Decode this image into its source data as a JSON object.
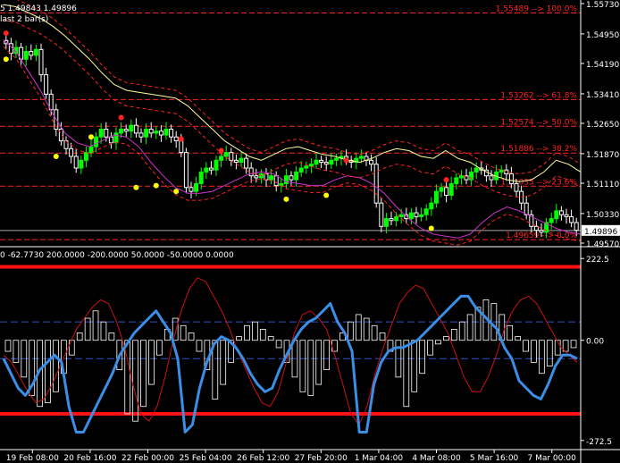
{
  "header": {
    "main_info": "5 1.49843 1.49896",
    "main_info2": "last 2 bar(s)",
    "ind_info": "0 -62.7730 200.0000 -200.0000 50.0000 -50.0000 0.0000"
  },
  "colors": {
    "background": "#000000",
    "axis": "#ffffff",
    "candle_bull": "#00ff00",
    "candle_bear": "#ffffff",
    "fib_line": "#ff2222",
    "env_line": "#ff2222",
    "outer_band": "#ffff99",
    "inner_band": "#cc33cc",
    "dot_top": "#ff2222",
    "dot_bottom": "#ffff00",
    "cci_main": "#3a8ee6",
    "cci_signal": "#cc1111",
    "cci_limit": "#ff1111",
    "cci_level": "#3355cc",
    "histogram": "#ffffff",
    "current_price_box": "#ffffff"
  },
  "chart_data": [
    {
      "type": "candlestick",
      "title": "",
      "ylim": [
        1.4957,
        1.5573
      ],
      "y_ticks": [
        "1.55730",
        "1.54950",
        "1.54190",
        "1.53410",
        "1.52650",
        "1.51870",
        "1.51110",
        "1.50330",
        "1.49896",
        "1.49570"
      ],
      "current_price": "1.49896",
      "fib_levels": [
        {
          "label": "1.55489 --> 100.0%",
          "value": 1.55489
        },
        {
          "label": "1.53262 --> 61.8%",
          "value": 1.53262
        },
        {
          "label": "1.52574 --> 50.0%",
          "value": 1.52574
        },
        {
          "label": "1.51886 --> 38.2%",
          "value": 1.51886
        },
        {
          "label": "1.51035 --> 23.6%",
          "value": 1.51035
        },
        {
          "label": "1.49659 --> 0.0%",
          "value": 1.49659
        }
      ],
      "close": [
        1.547,
        1.5445,
        1.546,
        1.543,
        1.545,
        1.544,
        1.5455,
        1.539,
        1.534,
        1.53,
        1.525,
        1.522,
        1.52,
        1.518,
        1.515,
        1.517,
        1.519,
        1.5205,
        1.523,
        1.525,
        1.523,
        1.5215,
        1.524,
        1.525,
        1.5245,
        1.526,
        1.524,
        1.523,
        1.525,
        1.524,
        1.5245,
        1.5235,
        1.525,
        1.523,
        1.522,
        1.519,
        1.51,
        1.509,
        1.511,
        1.514,
        1.515,
        1.5145,
        1.517,
        1.518,
        1.519,
        1.517,
        1.5165,
        1.5175,
        1.515,
        1.513,
        1.5125,
        1.5135,
        1.512,
        1.513,
        1.5105,
        1.511,
        1.513,
        1.512,
        1.514,
        1.515,
        1.5155,
        1.516,
        1.517,
        1.5165,
        1.516,
        1.517,
        1.5175,
        1.518,
        1.517,
        1.5165,
        1.5175,
        1.518,
        1.517,
        1.516,
        1.506,
        1.5,
        1.502,
        1.5015,
        1.5025,
        1.503,
        1.502,
        1.5035,
        1.5025,
        1.503,
        1.5045,
        1.506,
        1.509,
        1.51,
        1.508,
        1.511,
        1.5125,
        1.513,
        1.512,
        1.514,
        1.515,
        1.5145,
        1.513,
        1.512,
        1.514,
        1.5145,
        1.5135,
        1.511,
        1.509,
        1.506,
        1.503,
        1.5,
        1.499,
        1.4985,
        1.501,
        1.502,
        1.504,
        1.503,
        1.5025,
        1.501,
        1.499
      ],
      "outer_upper": [
        1.557,
        1.5565,
        1.555,
        1.5535,
        1.5515,
        1.549,
        1.546,
        1.543,
        1.5395,
        1.5365,
        1.535,
        1.5345,
        1.534,
        1.5335,
        1.533,
        1.531,
        1.528,
        1.525,
        1.522,
        1.52,
        1.518,
        1.517,
        1.5185,
        1.52,
        1.5205,
        1.5195,
        1.5185,
        1.518,
        1.517,
        1.5165,
        1.5175,
        1.519,
        1.52,
        1.5195,
        1.518,
        1.5175,
        1.5195,
        1.5175,
        1.5165,
        1.5145,
        1.513,
        1.512,
        1.5115,
        1.512,
        1.514,
        1.517,
        1.516,
        1.514
      ],
      "outer_lower": [
        1.548,
        1.545,
        1.54,
        1.535,
        1.529,
        1.524,
        1.5215,
        1.5205,
        1.522,
        1.5235,
        1.523,
        1.5205,
        1.5165,
        1.513,
        1.51,
        1.5085,
        1.5085,
        1.509,
        1.5105,
        1.512,
        1.5135,
        1.514,
        1.5135,
        1.5115,
        1.511,
        1.5105,
        1.5105,
        1.512,
        1.513,
        1.5125,
        1.511,
        1.5085,
        1.505,
        1.502,
        1.4995,
        1.498,
        1.4975,
        1.497,
        1.498,
        1.501,
        1.5035,
        1.505,
        1.504,
        1.5025,
        1.501,
        1.4995,
        1.4985,
        1.498
      ],
      "dots_top": [
        [
          0,
          1.5497
        ],
        [
          23,
          1.528
        ],
        [
          35,
          1.5225
        ],
        [
          43,
          1.5195
        ],
        [
          68,
          1.517
        ],
        [
          88,
          1.512
        ]
      ],
      "dots_bottom": [
        [
          0,
          1.543
        ],
        [
          10,
          1.518
        ],
        [
          17,
          1.523
        ],
        [
          26,
          1.51
        ],
        [
          30,
          1.5105
        ],
        [
          34,
          1.509
        ],
        [
          56,
          1.507
        ],
        [
          64,
          1.508
        ],
        [
          85,
          1.4995
        ]
      ]
    },
    {
      "type": "line",
      "title": "",
      "ylim": [
        -290,
        240
      ],
      "y_ticks": [
        "222.5",
        "0.00",
        "-272.5"
      ],
      "levels": {
        "upper": 200,
        "lower": -200,
        "mid_high": 50,
        "mid_low": -50,
        "zero": 0
      },
      "series": [
        {
          "values": [
            -50,
            -90,
            -130,
            -150,
            -120,
            -80,
            -60,
            -40,
            -60,
            -180,
            -250,
            -250,
            -210,
            -170,
            -130,
            -90,
            -40,
            -10,
            20,
            40,
            60,
            80,
            50,
            20,
            -50,
            -250,
            -230,
            -130,
            -60,
            -10,
            10,
            0,
            -20,
            -50,
            -90,
            -120,
            -140,
            -130,
            -80,
            -40,
            0,
            30,
            50,
            60,
            80,
            100,
            50,
            20,
            -30,
            -250,
            -250,
            -120,
            -60,
            -30,
            -20,
            -20,
            -10,
            0,
            20,
            40,
            60,
            80,
            100,
            120,
            120,
            90,
            70,
            50,
            30,
            -20,
            -50,
            -110,
            -130,
            -150,
            -160,
            -120,
            -70,
            -40,
            -40,
            -50
          ]
        },
        {
          "values": [
            -40,
            -60,
            -100,
            -140,
            -170,
            -160,
            -120,
            -70,
            -20,
            30,
            60,
            90,
            110,
            100,
            50,
            -20,
            -120,
            -200,
            -220,
            -180,
            -100,
            0,
            80,
            140,
            170,
            160,
            120,
            80,
            30,
            -30,
            -80,
            -130,
            -170,
            -180,
            -140,
            -60,
            20,
            70,
            80,
            60,
            30,
            -40,
            -120,
            -200,
            -230,
            -180,
            -90,
            -20,
            40,
            100,
            130,
            150,
            140,
            100,
            60,
            20,
            -40,
            -100,
            -140,
            -140,
            -100,
            -40,
            30,
            80,
            110,
            120,
            100,
            60,
            20,
            -20,
            -40,
            -60
          ]
        }
      ],
      "histogram": [
        -30,
        -60,
        -100,
        -150,
        -180,
        -170,
        -140,
        -90,
        -40,
        20,
        60,
        80,
        50,
        20,
        -80,
        -200,
        -220,
        -180,
        -120,
        -40,
        30,
        60,
        40,
        20,
        -30,
        -80,
        -160,
        -120,
        -60,
        10,
        40,
        50,
        30,
        10,
        -20,
        -60,
        -100,
        -140,
        -150,
        -120,
        -80,
        -30,
        20,
        50,
        70,
        60,
        40,
        20,
        -30,
        -100,
        -180,
        -140,
        -90,
        -40,
        -10,
        10,
        30,
        50,
        70,
        90,
        110,
        100,
        70,
        40,
        10,
        -30,
        -60,
        -90,
        -70,
        -40,
        -30,
        -20
      ]
    }
  ],
  "x_labels": [
    "19 Feb 08:00",
    "20 Feb 16:00",
    "22 Feb 00:00",
    "25 Feb 04:00",
    "26 Feb 12:00",
    "27 Feb 20:00",
    "1 Mar 04:00",
    "4 Mar 08:00",
    "5 Mar 16:00",
    "7 Mar 00:00"
  ]
}
